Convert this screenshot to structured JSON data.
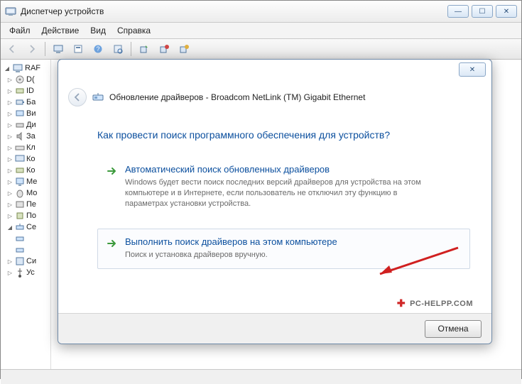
{
  "window": {
    "title": "Диспетчер устройств",
    "buttons": {
      "min": "—",
      "max": "☐",
      "close": "✕"
    }
  },
  "menubar": {
    "items": [
      "Файл",
      "Действие",
      "Вид",
      "Справка"
    ]
  },
  "tree": {
    "root": "RAF",
    "nodes": [
      "D(",
      "ID",
      "Ба",
      "Ви",
      "Ди",
      "За",
      "Кл",
      "Ко",
      "Ко",
      "Ме",
      "Мо",
      "Пе",
      "По",
      "Се",
      "",
      "",
      "Си",
      "Ус"
    ]
  },
  "dialog": {
    "title_prefix": "Обновление драйверов - ",
    "device": "Broadcom NetLink (TM) Gigabit Ethernet",
    "question": "Как провести поиск программного обеспечения для устройств?",
    "option1": {
      "title": "Автоматический поиск обновленных драйверов",
      "desc": "Windows будет вести поиск последних версий драйверов для устройства на этом компьютере и в Интернете, если пользователь не отключил эту функцию в параметрах установки устройства."
    },
    "option2": {
      "title": "Выполнить поиск драйверов на этом компьютере",
      "desc": "Поиск и установка драйверов вручную."
    },
    "cancel": "Отмена",
    "watermark": "PC-HELPP.COM"
  }
}
